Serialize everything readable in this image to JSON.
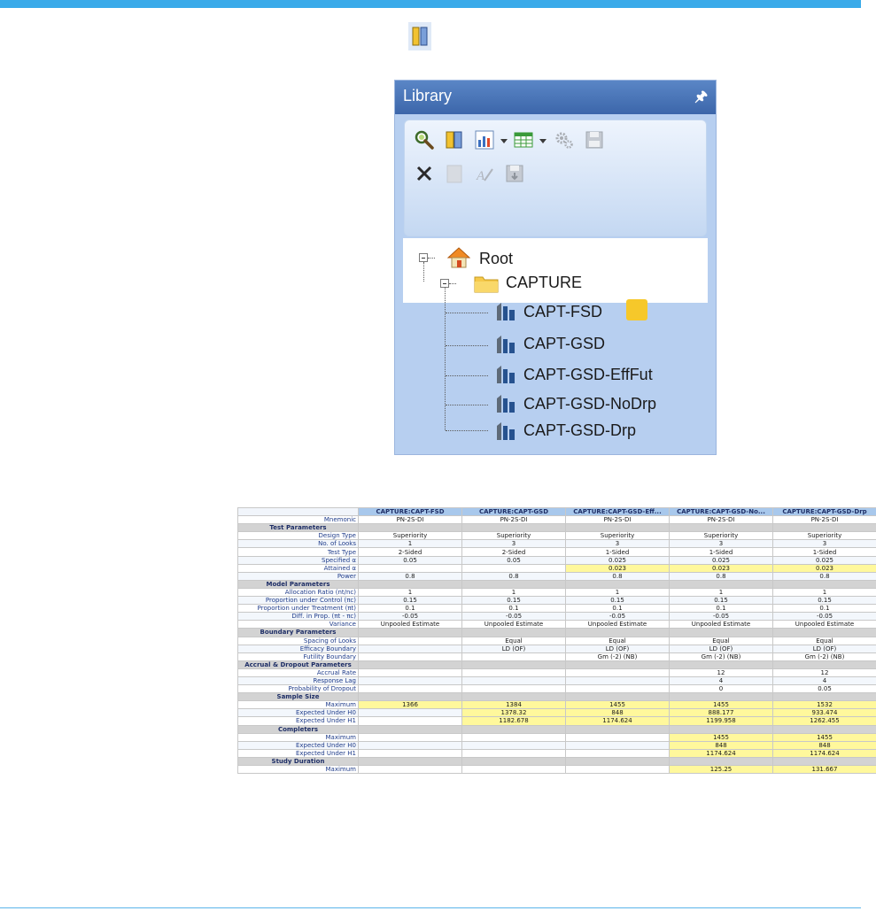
{
  "colors": {
    "top_bar": "#3aaae9",
    "bottom_line": "#5ab4ea",
    "library_header": "#4a76b8",
    "tree_selection": "#b7cff0",
    "highlight": "#fff89c",
    "note": "#f6c82a"
  },
  "top_icon": "chart-design-icon",
  "library": {
    "title": "Library",
    "pin_icon": "pin-icon",
    "toolbar_icons": [
      "magnifier-icon",
      "chart-design-icon",
      "plot-icon",
      "table-icon",
      "settings-icon",
      "save-icon",
      "delete-icon",
      "copy-icon",
      "rename-icon",
      "save-as-icon"
    ],
    "tree": {
      "root": "Root",
      "folder": "CAPTURE",
      "items": [
        "CAPT-FSD",
        "CAPT-GSD",
        "CAPT-GSD-EffFut",
        "CAPT-GSD-NoDrp",
        "CAPT-GSD-Drp"
      ]
    }
  },
  "table": {
    "headers": [
      "CAPTURE:CAPT-FSD",
      "CAPTURE:CAPT-GSD",
      "CAPTURE:CAPT-GSD-Eff...",
      "CAPTURE:CAPT-GSD-No...",
      "CAPTURE:CAPT-GSD-Drp"
    ],
    "rows": [
      {
        "label": "Mnemonic",
        "values": [
          "PN-2S-DI",
          "PN-2S-DI",
          "PN-2S-DI",
          "PN-2S-DI",
          "PN-2S-DI"
        ]
      },
      {
        "section": "Test Parameters"
      },
      {
        "label": "Design Type",
        "values": [
          "Superiority",
          "Superiority",
          "Superiority",
          "Superiority",
          "Superiority"
        ]
      },
      {
        "label": "No. of Looks",
        "values": [
          "1",
          "3",
          "3",
          "3",
          "3"
        ]
      },
      {
        "label": "Test Type",
        "values": [
          "2-Sided",
          "2-Sided",
          "1-Sided",
          "1-Sided",
          "1-Sided"
        ]
      },
      {
        "label": "Specified α",
        "values": [
          "0.05",
          "0.05",
          "0.025",
          "0.025",
          "0.025"
        ]
      },
      {
        "label": "Attained α",
        "values": [
          "",
          "",
          "0.023",
          "0.023",
          "0.023"
        ],
        "hl": [
          2,
          3,
          4
        ]
      },
      {
        "label": "Power",
        "values": [
          "0.8",
          "0.8",
          "0.8",
          "0.8",
          "0.8"
        ]
      },
      {
        "section": "Model Parameters"
      },
      {
        "label": "Allocation Ratio (nt/nc)",
        "values": [
          "1",
          "1",
          "1",
          "1",
          "1"
        ]
      },
      {
        "label": "Proportion under Control (πc)",
        "values": [
          "0.15",
          "0.15",
          "0.15",
          "0.15",
          "0.15"
        ]
      },
      {
        "label": "Proportion under Treatment (πt)",
        "values": [
          "0.1",
          "0.1",
          "0.1",
          "0.1",
          "0.1"
        ]
      },
      {
        "label": "Diff. in Prop. (πt - πc)",
        "values": [
          "-0.05",
          "-0.05",
          "-0.05",
          "-0.05",
          "-0.05"
        ]
      },
      {
        "label": "Variance",
        "values": [
          "Unpooled Estimate",
          "Unpooled Estimate",
          "Unpooled Estimate",
          "Unpooled Estimate",
          "Unpooled Estimate"
        ]
      },
      {
        "section": "Boundary Parameters"
      },
      {
        "label": "Spacing of Looks",
        "values": [
          "",
          "Equal",
          "Equal",
          "Equal",
          "Equal"
        ]
      },
      {
        "label": "Efficacy Boundary",
        "values": [
          "",
          "LD (OF)",
          "LD (OF)",
          "LD (OF)",
          "LD (OF)"
        ]
      },
      {
        "label": "Futility Boundary",
        "values": [
          "",
          "",
          "Gm (-2) (NB)",
          "Gm (-2) (NB)",
          "Gm (-2) (NB)"
        ]
      },
      {
        "section": "Accrual & Dropout Parameters"
      },
      {
        "label": "Accrual Rate",
        "values": [
          "",
          "",
          "",
          "12",
          "12"
        ]
      },
      {
        "label": "Response Lag",
        "values": [
          "",
          "",
          "",
          "4",
          "4"
        ]
      },
      {
        "label": "Probability of Dropout",
        "values": [
          "",
          "",
          "",
          "0",
          "0.05"
        ]
      },
      {
        "section": "Sample Size"
      },
      {
        "label": "Maximum",
        "values": [
          "1366",
          "1384",
          "1455",
          "1455",
          "1532"
        ],
        "hl": [
          0,
          1,
          2,
          3,
          4
        ]
      },
      {
        "label": "Expected Under H0",
        "values": [
          "",
          "1378.32",
          "848",
          "888.177",
          "933.474"
        ],
        "hl": [
          1,
          2,
          3,
          4
        ]
      },
      {
        "label": "Expected Under H1",
        "values": [
          "",
          "1182.678",
          "1174.624",
          "1199.958",
          "1262.455"
        ],
        "hl": [
          1,
          2,
          3,
          4
        ]
      },
      {
        "section": "Completers"
      },
      {
        "label": "Maximum",
        "values": [
          "",
          "",
          "",
          "1455",
          "1455"
        ],
        "hl": [
          3,
          4
        ]
      },
      {
        "label": "Expected Under H0",
        "values": [
          "",
          "",
          "",
          "848",
          "848"
        ],
        "hl": [
          3,
          4
        ]
      },
      {
        "label": "Expected Under H1",
        "values": [
          "",
          "",
          "",
          "1174.624",
          "1174.624"
        ],
        "hl": [
          3,
          4
        ]
      },
      {
        "section": "Study Duration"
      },
      {
        "label": "Maximum",
        "values": [
          "",
          "",
          "",
          "125.25",
          "131.667"
        ],
        "hl": [
          3,
          4
        ]
      }
    ]
  }
}
